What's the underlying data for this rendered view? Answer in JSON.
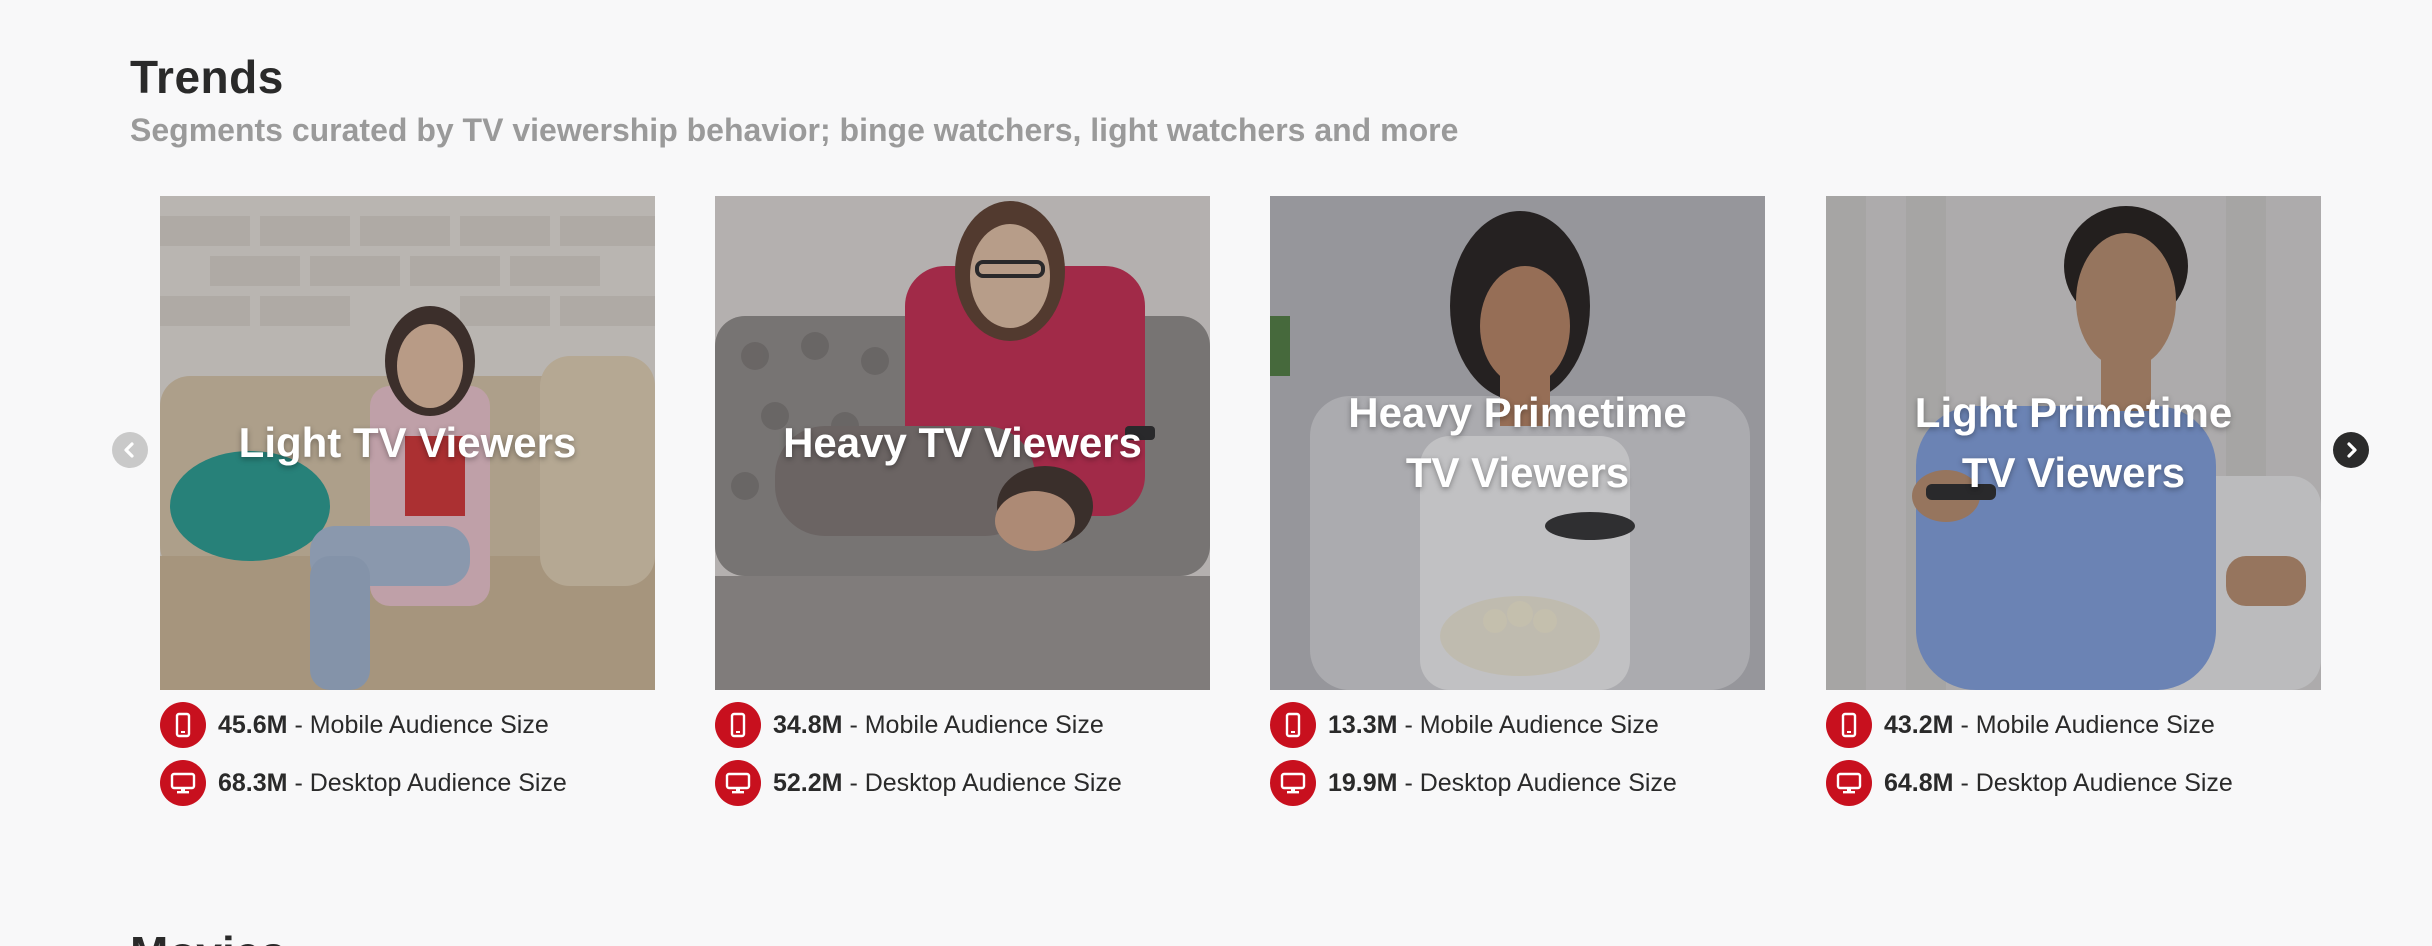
{
  "section": {
    "title": "Trends",
    "subtitle": "Segments curated by TV viewership behavior; binge watchers, light watchers and more"
  },
  "next_section": {
    "title": "Movies"
  },
  "carousel": {
    "prev_icon": "chevron-left-icon",
    "next_icon": "chevron-right-icon",
    "cards": [
      {
        "title": "Light TV Viewers",
        "mobile_value": "45.6M",
        "mobile_label": "Mobile Audience Size",
        "desktop_value": "68.3M",
        "desktop_label": "Desktop Audience Size"
      },
      {
        "title": "Heavy TV Viewers",
        "mobile_value": "34.8M",
        "mobile_label": "Mobile Audience Size",
        "desktop_value": "52.2M",
        "desktop_label": "Desktop Audience Size"
      },
      {
        "title": "Heavy Primetime TV Viewers",
        "mobile_value": "13.3M",
        "mobile_label": "Mobile Audience Size",
        "desktop_value": "19.9M",
        "desktop_label": "Desktop Audience Size"
      },
      {
        "title": "Light Primetime TV Viewers",
        "mobile_value": "43.2M",
        "mobile_label": "Mobile Audience Size",
        "desktop_value": "64.8M",
        "desktop_label": "Desktop Audience Size"
      }
    ]
  },
  "separator": "-",
  "colors": {
    "accent": "#c8101e",
    "background": "#f8f8f9",
    "title": "#2a2a2a",
    "subtitle": "#9a9a9a"
  }
}
